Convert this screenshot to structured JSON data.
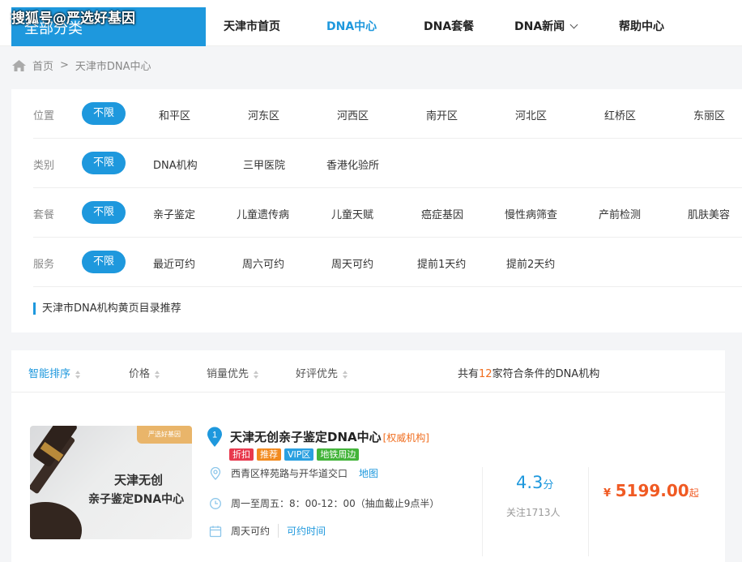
{
  "watermark": "搜狐号@严选好基因",
  "nav": {
    "all_categories": "全部分类",
    "items": [
      {
        "label": "天津市首页"
      },
      {
        "label": "DNA中心"
      },
      {
        "label": "DNA套餐"
      },
      {
        "label": "DNA新闻"
      },
      {
        "label": "帮助中心"
      }
    ],
    "active_index": 1
  },
  "breadcrumb": {
    "home": "首页",
    "sep": ">",
    "current": "天津市DNA中心"
  },
  "filters": {
    "unlimited": "不限",
    "rows": [
      {
        "label": "位置",
        "options": [
          "和平区",
          "河东区",
          "河西区",
          "南开区",
          "河北区",
          "红桥区",
          "东丽区"
        ]
      },
      {
        "label": "类别",
        "options": [
          "DNA机构",
          "三甲医院",
          "香港化验所"
        ]
      },
      {
        "label": "套餐",
        "options": [
          "亲子鉴定",
          "儿童遗传病",
          "儿童天赋",
          "癌症基因",
          "慢性病筛查",
          "产前检测",
          "肌肤美容"
        ]
      },
      {
        "label": "服务",
        "options": [
          "最近可约",
          "周六可约",
          "周天可约",
          "提前1天约",
          "提前2天约"
        ]
      }
    ],
    "recommend": "天津市DNA机构黄页目录推荐"
  },
  "sortbar": {
    "sorts": [
      "智能排序",
      "价格",
      "销量优先",
      "好评优先"
    ],
    "active_index": 0,
    "count_prefix": "共有",
    "count": "12",
    "count_suffix": "家符合条件的DNA机构"
  },
  "listing": {
    "rank": "1",
    "name": "天津无创亲子鉴定DNA中心",
    "badge": "[权威机构]",
    "tags": [
      {
        "label": "折扣",
        "color": "#e8394d"
      },
      {
        "label": "推荐",
        "color": "#f28a1e"
      },
      {
        "label": "VIP区",
        "color": "#2aa0e0"
      },
      {
        "label": "地铁周边",
        "color": "#43b43a"
      }
    ],
    "address": "西青区梓苑路与开华道交口",
    "map_link": "地图",
    "hours": "周一至周五：8：00-12：00（抽血截止9点半）",
    "availability": "周天可约",
    "book_link": "可约时间",
    "rating": "4.3",
    "rating_unit": "分",
    "followers": "关注1713人",
    "currency": "¥",
    "price": "5199.00",
    "price_suffix": "起",
    "image": {
      "brand": "严选好基因",
      "line1": "天津无创",
      "line2": "亲子鉴定DNA中心"
    }
  },
  "colors": {
    "accent": "#1e98dd",
    "price": "#f05a23",
    "count": "#f06d1e"
  }
}
